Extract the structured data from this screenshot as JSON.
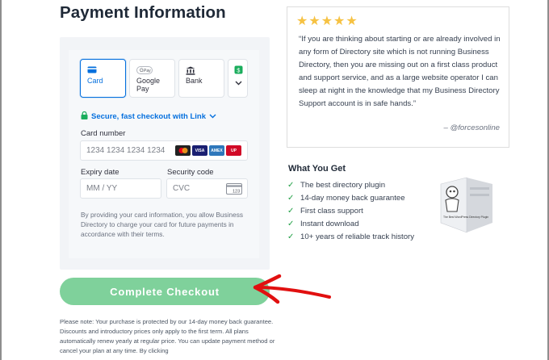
{
  "title": "Payment Information",
  "payment_methods": [
    {
      "label": "Card",
      "icon": "card-icon",
      "selected": true
    },
    {
      "label": "Google Pay",
      "icon": "google-pay-icon",
      "selected": false
    },
    {
      "label": "Bank",
      "icon": "bank-icon",
      "selected": false
    },
    {
      "label": "",
      "icon": "more-methods-icon",
      "selected": false
    }
  ],
  "link_checkout": {
    "label": "Secure, fast checkout with Link",
    "icon": "lock-icon"
  },
  "card_number": {
    "label": "Card number",
    "placeholder": "1234 1234 1234 1234",
    "brands": [
      "mastercard",
      "visa",
      "amex",
      "unionpay"
    ]
  },
  "expiry": {
    "label": "Expiry date",
    "placeholder": "MM / YY"
  },
  "cvc": {
    "label": "Security code",
    "placeholder": "CVC",
    "icon_text": "123"
  },
  "disclaimer": "By providing your card information, you allow Business Directory to charge your card for future payments in accordance with their terms.",
  "checkout_button": "Complete Checkout",
  "note": "Please note: Your purchase is protected by our 14-day money back guarantee. Discounts and introductory prices only apply to the first term. All plans automatically renew yearly at regular price. You can update payment method or cancel your plan at any time. By clicking",
  "testimonial": {
    "rating": 5,
    "quote": "“If you are thinking about starting or are already involved in any form of Directory site which is not running Business Directory, then you are missing out on a first class product and support service, and as a large website operator I can sleep at night in the knowledge that my Business Directory Support account is in safe hands.”",
    "author": "– @forcesonline"
  },
  "what_you_get": {
    "title": "What You Get",
    "items": [
      "The best directory plugin",
      "14-day money back guarantee",
      "First class support",
      "Instant download",
      "10+ years of reliable track history"
    ]
  },
  "product_box_text": "The Best WordPress Directory Plugin",
  "colors": {
    "accent": "#0570de",
    "button": "#7fd19b",
    "check": "#21a045",
    "star": "#f6c243",
    "arrow": "#e11010"
  }
}
